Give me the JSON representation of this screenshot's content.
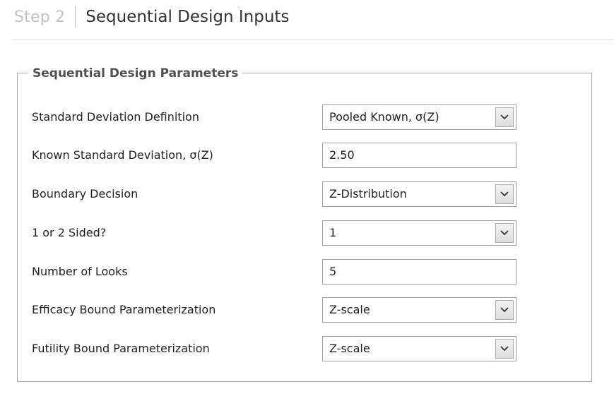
{
  "header": {
    "step": "Step 2",
    "title": "Sequential Design Inputs"
  },
  "group": {
    "title": "Sequential Design Parameters"
  },
  "fields": [
    {
      "label": "Standard Deviation Definition",
      "type": "dropdown",
      "value": "Pooled Known, σ(Z)"
    },
    {
      "label": "Known Standard Deviation, σ(Z)",
      "type": "text",
      "value": "2.50"
    },
    {
      "label": "Boundary Decision",
      "type": "dropdown",
      "value": "Z-Distribution"
    },
    {
      "label": "1 or 2 Sided?",
      "type": "dropdown",
      "value": "1"
    },
    {
      "label": "Number of Looks",
      "type": "text",
      "value": "5"
    },
    {
      "label": "Efficacy Bound Parameterization",
      "type": "dropdown",
      "value": "Z-scale"
    },
    {
      "label": "Futility Bound Parameterization",
      "type": "dropdown",
      "value": "Z-scale"
    }
  ],
  "icons": {
    "dropdown": "chevron-down-icon"
  }
}
